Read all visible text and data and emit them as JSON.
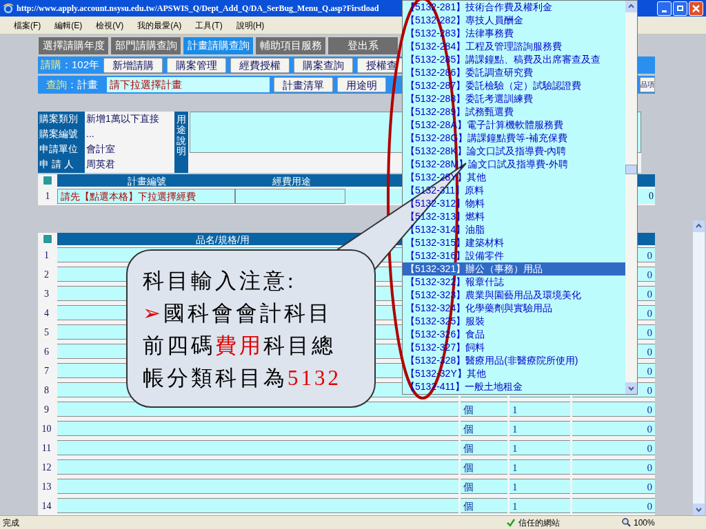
{
  "window": {
    "title": "http://www.apply.account.nsysu.edu.tw/APSWIS_Q/Dept_Add_Q/DA_SerBug_Menu_Q.asp?Firstload"
  },
  "menu": [
    "檔案(F)",
    "編輯(E)",
    "檢視(V)",
    "我的最愛(A)",
    "工具(T)",
    "說明(H)"
  ],
  "tabs": [
    {
      "label": "選擇請購年度",
      "selected": false
    },
    {
      "label": "部門請購查詢",
      "selected": false
    },
    {
      "label": "計畫請購查詢",
      "selected": true
    },
    {
      "label": "輔助項目服務",
      "selected": false
    },
    {
      "label": "登出系",
      "selected": false
    }
  ],
  "request_bar": {
    "label": "請購",
    "value": "：102年",
    "buttons": [
      "新增請購",
      "購案管理",
      "經費授權",
      "購案查詢",
      "授權查"
    ]
  },
  "query_bar": {
    "label": "查詢",
    "value": "：計畫",
    "select": {
      "value": "請下拉選擇計畫"
    },
    "buttons": [
      "計畫清單",
      "用途明"
    ],
    "right_button": "品項"
  },
  "info": {
    "fields": [
      {
        "label": "購案類別",
        "value": "新增1萬以下直接"
      },
      {
        "label": "購案編號",
        "value": "..."
      },
      {
        "label": "申請單位",
        "value": "會計室"
      },
      {
        "label": "申 請 人",
        "value": "周英君"
      }
    ],
    "purpose_label": "用途說明"
  },
  "plan_table": {
    "columns": [
      "計畫編號",
      "經費用途"
    ],
    "rows": [
      {
        "index": "1",
        "plan": "請先【點選本格】下拉選擇經費",
        "amount": "0"
      }
    ]
  },
  "item_table": {
    "columns": [
      "品名/規格/用"
    ],
    "rows": [
      {
        "index": "1",
        "amount": "0"
      },
      {
        "index": "2",
        "amount": "0"
      },
      {
        "index": "3",
        "amount": "0"
      },
      {
        "index": "4",
        "amount": "0"
      },
      {
        "index": "5",
        "amount": "0"
      },
      {
        "index": "6",
        "amount": "0"
      },
      {
        "index": "7",
        "amount": "0"
      },
      {
        "index": "8",
        "amount": "0"
      },
      {
        "index": "9",
        "unit": "個",
        "qty": "1",
        "amount": "0"
      },
      {
        "index": "10",
        "unit": "個",
        "qty": "1",
        "amount": "0"
      },
      {
        "index": "11",
        "unit": "個",
        "qty": "1",
        "amount": "0"
      },
      {
        "index": "12",
        "unit": "個",
        "qty": "1",
        "amount": "0"
      },
      {
        "index": "13",
        "unit": "個",
        "qty": "1",
        "amount": "0"
      },
      {
        "index": "14",
        "unit": "個",
        "qty": "1",
        "amount": "0"
      }
    ]
  },
  "dropdown": {
    "items": [
      {
        "code": "【5132-281】",
        "name": "技術合作費及權利金",
        "selected": false
      },
      {
        "code": "【5132-282】",
        "name": "專技人員酬金",
        "selected": false
      },
      {
        "code": "【5132-283】",
        "name": "法律事務費",
        "selected": false
      },
      {
        "code": "【5132-284】",
        "name": "工程及管理諮詢服務費",
        "selected": false
      },
      {
        "code": "【5132-285】",
        "name": "講課鐘點、稿費及出席審查及查",
        "selected": false
      },
      {
        "code": "【5132-286】",
        "name": "委託調查研究費",
        "selected": false
      },
      {
        "code": "【5132-287】",
        "name": "委託檢驗（定）試驗認證費",
        "selected": false
      },
      {
        "code": "【5132-288】",
        "name": "委託考選訓練費",
        "selected": false
      },
      {
        "code": "【5132-289】",
        "name": "試務甄選費",
        "selected": false
      },
      {
        "code": "【5132-28A】",
        "name": "電子計算機軟體服務費",
        "selected": false
      },
      {
        "code": "【5132-28G】",
        "name": "講課鐘點費等-補充保費",
        "selected": false
      },
      {
        "code": "【5132-28K】",
        "name": "論文口試及指導費-內聘",
        "selected": false
      },
      {
        "code": "【5132-28M】",
        "name": "論文口試及指導費-外聘",
        "selected": false
      },
      {
        "code": "【5132-28Y】",
        "name": "其他",
        "selected": false
      },
      {
        "code": "【5132-311】",
        "name": "原料",
        "selected": false
      },
      {
        "code": "【5132-312】",
        "name": "物料",
        "selected": false
      },
      {
        "code": "【5132-313】",
        "name": "燃料",
        "selected": false
      },
      {
        "code": "【5132-314】",
        "name": "油脂",
        "selected": false
      },
      {
        "code": "【5132-315】",
        "name": "建築材料",
        "selected": false
      },
      {
        "code": "【5132-316】",
        "name": "設備零件",
        "selected": false
      },
      {
        "code": "【5132-321】",
        "name": "辦公（事務）用品",
        "selected": true
      },
      {
        "code": "【5132-322】",
        "name": "報章什誌",
        "selected": false
      },
      {
        "code": "【5132-323】",
        "name": "農業與園藝用品及環境美化",
        "selected": false
      },
      {
        "code": "【5132-324】",
        "name": "化學藥劑與實驗用品",
        "selected": false
      },
      {
        "code": "【5132-325】",
        "name": "服裝",
        "selected": false
      },
      {
        "code": "【5132-326】",
        "name": "食品",
        "selected": false
      },
      {
        "code": "【5132-327】",
        "name": "飼料",
        "selected": false
      },
      {
        "code": "【5132-328】",
        "name": "醫療用品(非醫療院所使用)",
        "selected": false
      },
      {
        "code": "【5132-32Y】",
        "name": "其他",
        "selected": false
      },
      {
        "code": "【5132-411】",
        "name": "一般土地租金",
        "selected": false
      }
    ]
  },
  "callout": {
    "lines": [
      [
        {
          "text": "科目輸入注意:",
          "highlight": false
        }
      ],
      [
        {
          "text": "➢",
          "highlight": true
        },
        {
          "text": "國科會會計科目",
          "highlight": false
        }
      ],
      [
        {
          "text": "前四碼",
          "highlight": false
        },
        {
          "text": "費用",
          "highlight": true
        },
        {
          "text": "科目總",
          "highlight": false
        }
      ],
      [
        {
          "text": "帳分類科目為",
          "highlight": false
        },
        {
          "text": "5132",
          "highlight": true
        }
      ]
    ]
  },
  "status_bar": {
    "text": "完成",
    "zone": "信任的網站",
    "zoom": "100%"
  }
}
